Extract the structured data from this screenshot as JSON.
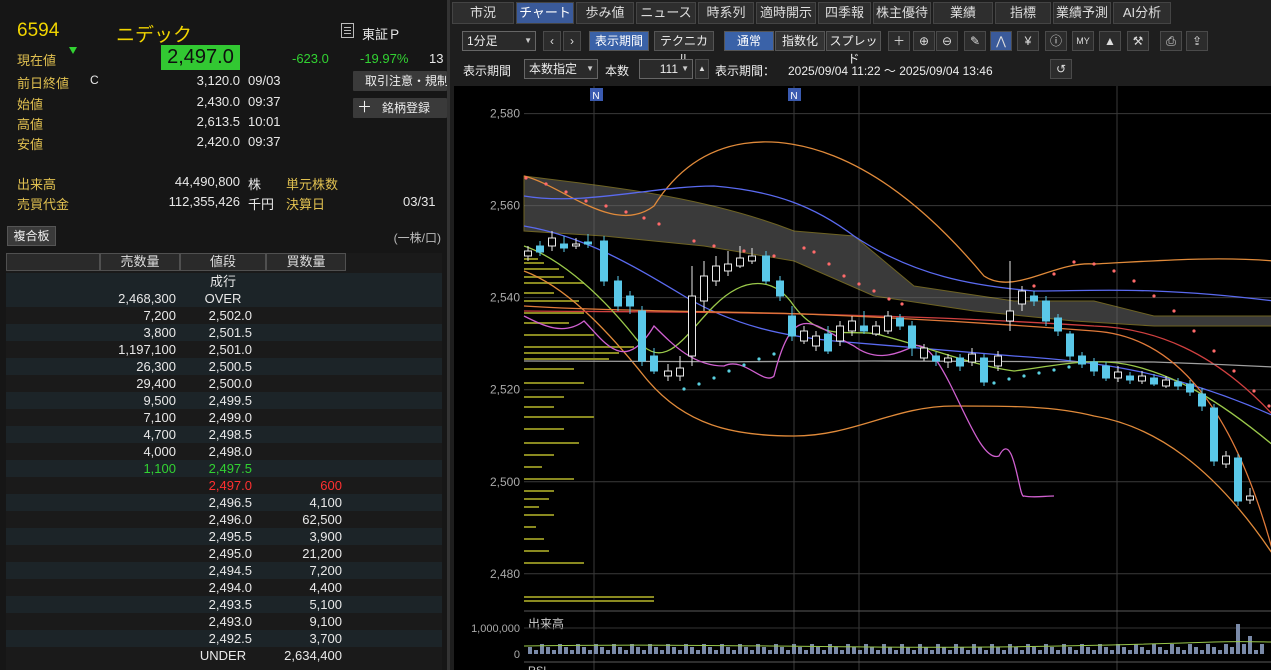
{
  "stock": {
    "code": "6594",
    "name": "ニデック",
    "market": "東証Ｐ",
    "current_label": "現在値",
    "current_price": "2,497.0",
    "change": "-623.0",
    "change_pct": "-19.97%",
    "change_time_cut": "13",
    "prev_close_label": "前日終値",
    "prev_close_flag": "C",
    "prev_close": "3,120.0",
    "prev_close_date": "09/03",
    "open_label": "始値",
    "open": "2,430.0",
    "open_time": "09:37",
    "high_label": "高値",
    "high": "2,613.5",
    "high_time": "10:01",
    "low_label": "安値",
    "low": "2,420.0",
    "low_time": "09:37",
    "volume_label": "出来高",
    "volume": "44,490,800",
    "volume_unit": "株",
    "turnover_label": "売買代金",
    "turnover": "112,355,426",
    "turnover_unit": "千円",
    "lot_label": "単元株数",
    "settle_label": "決算日",
    "settle_date": "03/31"
  },
  "buttons": {
    "trade_notice": "取引注意・規制",
    "add_watch": "銘柄登録",
    "composite_board": "複合板",
    "unit_note": "(一株/口)"
  },
  "book": {
    "headers": [
      "売数量",
      "値段",
      "買数量"
    ],
    "market_order": "成行",
    "rows": [
      {
        "sell": "2,468,300",
        "price": "OVER",
        "buy": ""
      },
      {
        "sell": "7,200",
        "price": "2,502.0",
        "buy": ""
      },
      {
        "sell": "3,800",
        "price": "2,501.5",
        "buy": ""
      },
      {
        "sell": "1,197,100",
        "price": "2,501.0",
        "buy": ""
      },
      {
        "sell": "26,300",
        "price": "2,500.5",
        "buy": ""
      },
      {
        "sell": "29,400",
        "price": "2,500.0",
        "buy": ""
      },
      {
        "sell": "9,500",
        "price": "2,499.5",
        "buy": ""
      },
      {
        "sell": "7,100",
        "price": "2,499.0",
        "buy": ""
      },
      {
        "sell": "4,700",
        "price": "2,498.5",
        "buy": ""
      },
      {
        "sell": "4,000",
        "price": "2,498.0",
        "buy": ""
      },
      {
        "sell": "1,100",
        "price": "2,497.5",
        "buy": ""
      },
      {
        "sell": "",
        "price": "2,497.0",
        "buy": "600"
      },
      {
        "sell": "",
        "price": "2,496.5",
        "buy": "4,100"
      },
      {
        "sell": "",
        "price": "2,496.0",
        "buy": "62,500"
      },
      {
        "sell": "",
        "price": "2,495.5",
        "buy": "3,900"
      },
      {
        "sell": "",
        "price": "2,495.0",
        "buy": "21,200"
      },
      {
        "sell": "",
        "price": "2,494.5",
        "buy": "7,200"
      },
      {
        "sell": "",
        "price": "2,494.0",
        "buy": "4,400"
      },
      {
        "sell": "",
        "price": "2,493.5",
        "buy": "5,100"
      },
      {
        "sell": "",
        "price": "2,493.0",
        "buy": "9,100"
      },
      {
        "sell": "",
        "price": "2,492.5",
        "buy": "3,700"
      },
      {
        "sell": "",
        "price": "UNDER",
        "buy": "2,634,400"
      }
    ]
  },
  "tabs": [
    "市況",
    "チャート",
    "歩み値",
    "ニュース",
    "時系列",
    "適時開示",
    "四季報",
    "株主優待",
    "業績",
    "指標",
    "業績予測",
    "AI分析"
  ],
  "active_tab": "チャート",
  "toolbar": {
    "interval": "1分足",
    "display_period": "表示期間",
    "technical": "テクニカル",
    "normal": "通常",
    "index": "指数化",
    "spread": "スプレッド"
  },
  "toolbar2": {
    "period_label": "表示期間",
    "period_mode": "本数指定",
    "count_label": "本数",
    "count": "111",
    "range_label": "表示期間：",
    "range": "2025/09/04 11:22 ～ 2025/09/04 13:46"
  },
  "chart_data": {
    "type": "candlestick",
    "y_ticks": [
      "2,580",
      "2,560",
      "2,540",
      "2,520",
      "2,500",
      "2,480"
    ],
    "ylim": [
      2473,
      2586
    ],
    "news_markers": [
      "N",
      "N"
    ],
    "volume_label": "出来高",
    "volume_ticks": [
      "1,000,000",
      "0"
    ],
    "bottom_label": "RSI",
    "colors": {
      "up": "#e8e8e8",
      "down": "#5ac8e8"
    }
  }
}
